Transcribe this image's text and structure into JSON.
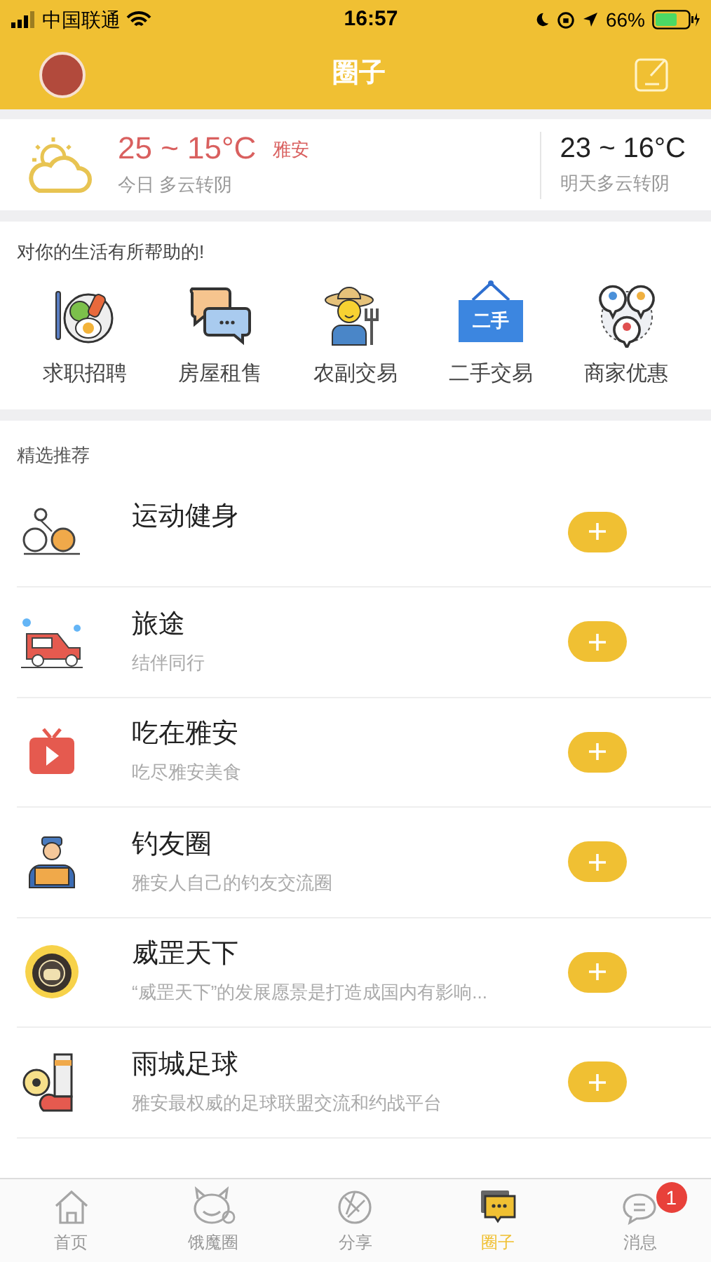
{
  "status_bar": {
    "carrier": "中国联通",
    "time": "16:57",
    "battery": "66%"
  },
  "nav_bar": {
    "title": "圈子"
  },
  "weather": {
    "today": {
      "temp": "25 ~ 15°C",
      "city": "雅安",
      "summary": "今日 多云转阴"
    },
    "tomorrow": {
      "temp": "23 ~ 16°C",
      "summary": "明天多云转阴"
    }
  },
  "services": {
    "title": "对你的生活有所帮助的!",
    "items": [
      {
        "label": "求职招聘"
      },
      {
        "label": "房屋租售"
      },
      {
        "label": "农副交易"
      },
      {
        "label": "二手交易",
        "sign_text": "二手"
      },
      {
        "label": "商家优惠"
      }
    ]
  },
  "featured": {
    "title": "精选推荐",
    "items": [
      {
        "title": "运动健身"
      },
      {
        "title": "旅途",
        "subtitle": "结伴同行"
      },
      {
        "title": "吃在雅安",
        "subtitle": "吃尽雅安美食"
      },
      {
        "title": "钓友圈",
        "subtitle": "雅安人自己的钓友交流圈"
      },
      {
        "title": "威罡天下",
        "subtitle": "“威罡天下”的发展愿景是打造成国内有影响..."
      },
      {
        "title": "雨城足球",
        "subtitle": "雅安最权威的足球联盟交流和约战平台"
      }
    ]
  },
  "tab_bar": [
    {
      "label": "首页",
      "selected": false
    },
    {
      "label": "饿魔圈",
      "selected": false
    },
    {
      "label": "分享",
      "selected": false
    },
    {
      "label": "圈子",
      "selected": true
    },
    {
      "label": "消息",
      "selected": false,
      "badge": "1"
    }
  ]
}
